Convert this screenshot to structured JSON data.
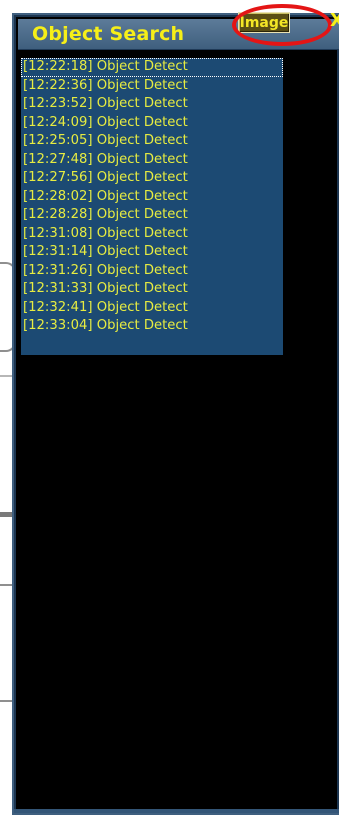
{
  "panel": {
    "title": "Object Search",
    "image_button_label": "Image",
    "close_label": "X"
  },
  "colors": {
    "title_text": "#f6ef18",
    "panel_border": "#3f5f7f",
    "list_background": "#1c4a73",
    "log_text": "#e7ec41",
    "highlight": "#e41515"
  },
  "log": {
    "items": [
      {
        "label": "[12:22:18] Object Detect"
      },
      {
        "label": "[12:22:36] Object Detect"
      },
      {
        "label": "[12:23:52] Object Detect"
      },
      {
        "label": "[12:24:09] Object Detect"
      },
      {
        "label": "[12:25:05] Object Detect"
      },
      {
        "label": "[12:27:48] Object Detect"
      },
      {
        "label": "[12:27:56] Object Detect"
      },
      {
        "label": "[12:28:02] Object Detect"
      },
      {
        "label": "[12:28:28] Object Detect"
      },
      {
        "label": "[12:31:08] Object Detect"
      },
      {
        "label": "[12:31:14] Object Detect"
      },
      {
        "label": "[12:31:26] Object Detect"
      },
      {
        "label": "[12:31:33] Object Detect"
      },
      {
        "label": "[12:32:41] Object Detect"
      },
      {
        "label": "[12:33:04] Object Detect"
      }
    ]
  }
}
